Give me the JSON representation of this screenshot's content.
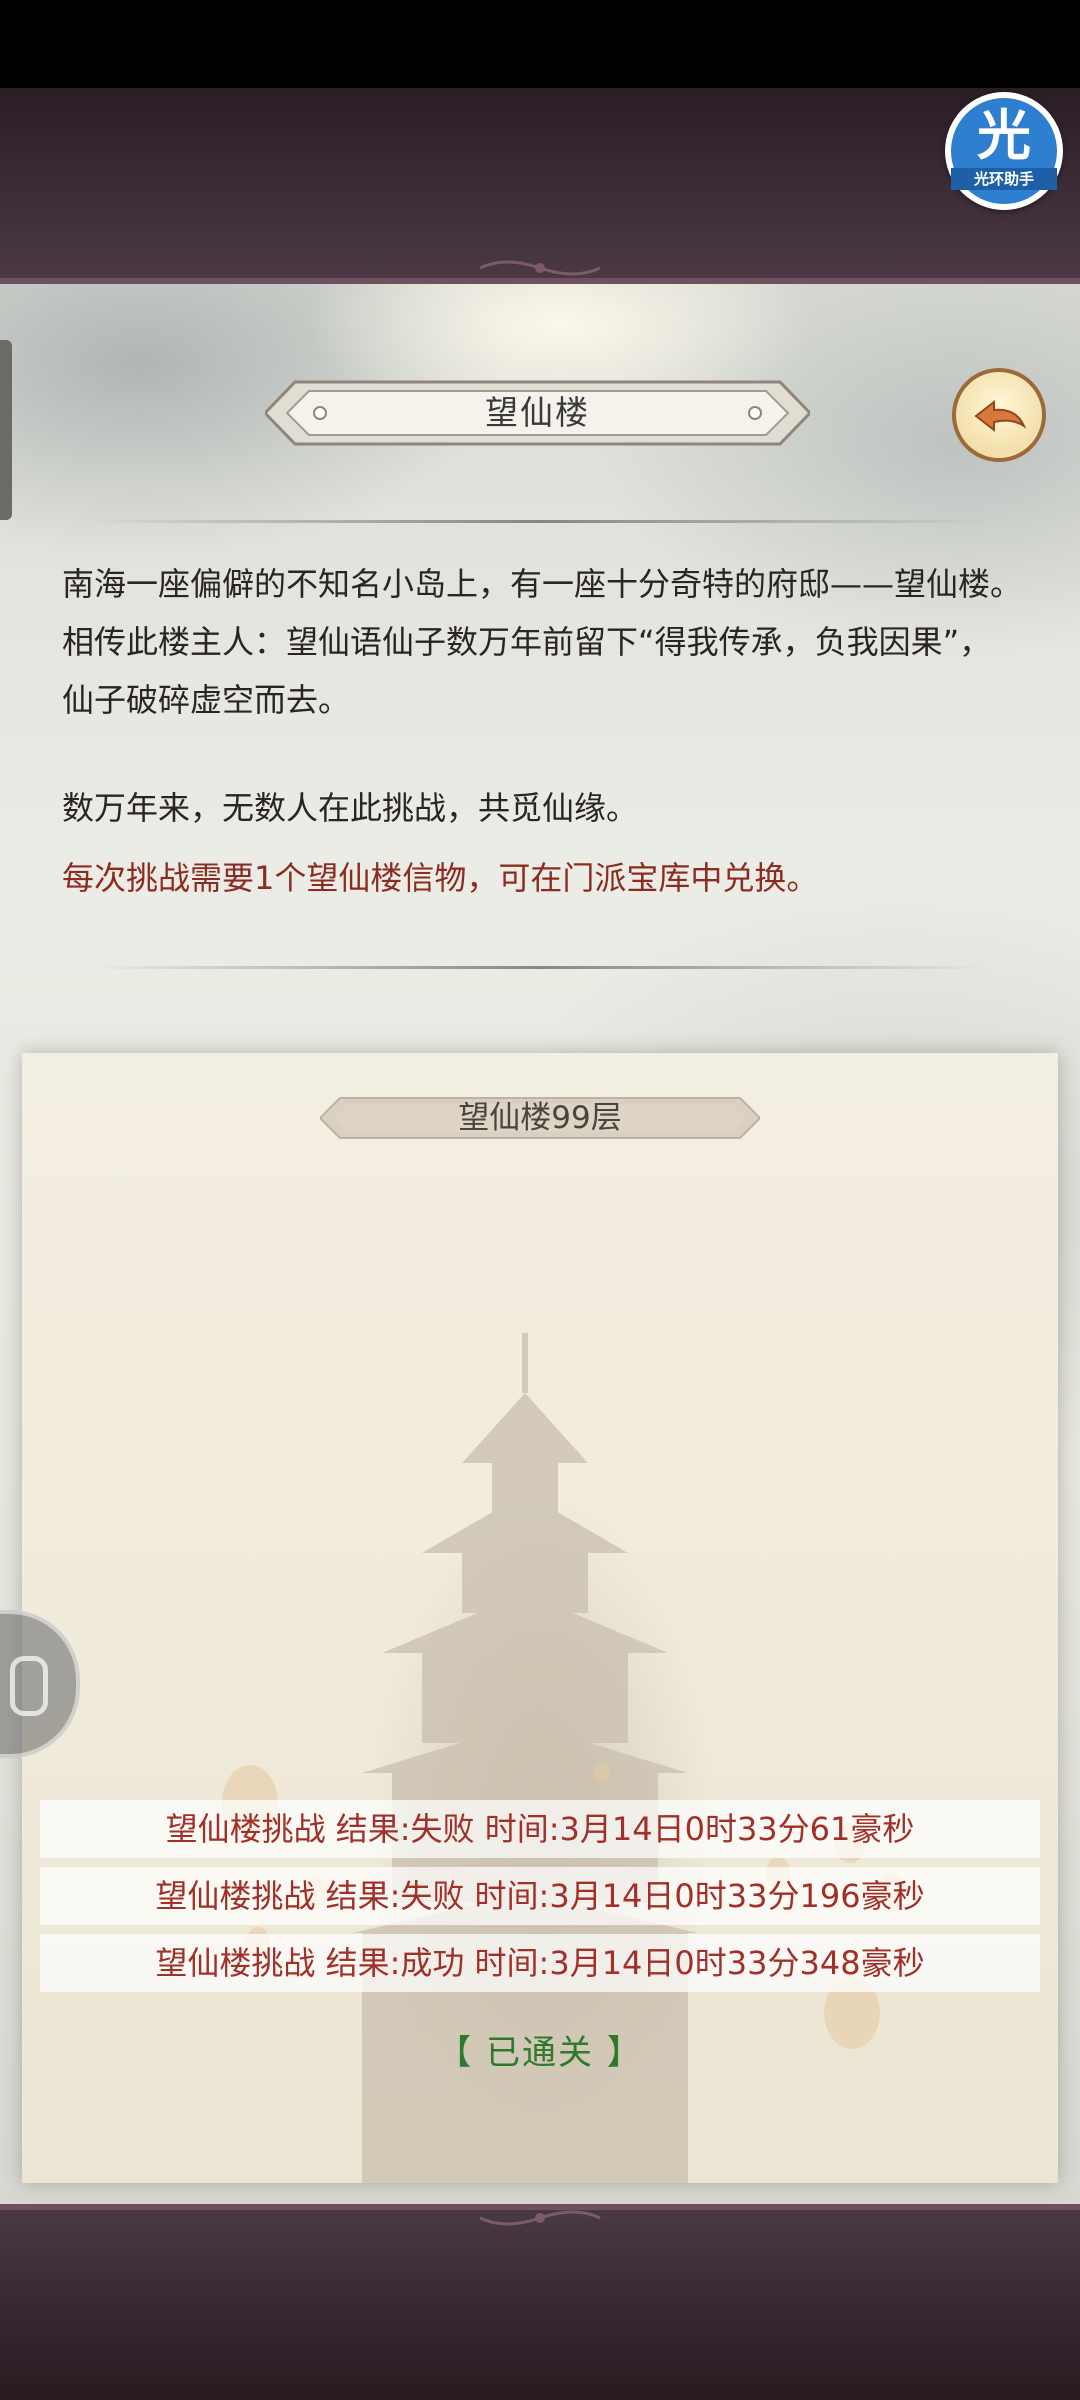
{
  "header": {
    "title": "望仙楼",
    "back_icon": "back-arrow-icon"
  },
  "helper_badge": {
    "glyph": "光",
    "label": "光环助手",
    "color": "#2f7fd0"
  },
  "intro": {
    "paragraph1": "南海一座偏僻的不知名小岛上，有一座十分奇特的府邸——望仙楼。相传此楼主人：望仙语仙子数万年前留下“得我传承，负我因果”，仙子破碎虚空而去。",
    "paragraph2": "数万年来，无数人在此挑战，共觅仙缘。",
    "note": "每次挑战需要1个望仙楼信物，可在门派宝库中兑换。",
    "note_color": "#8c2c20"
  },
  "tower": {
    "floor_label": "望仙楼99层",
    "records": [
      "望仙楼挑战 结果:失败 时间:3月14日0时33分61豪秒",
      "望仙楼挑战 结果:失败 时间:3月14日0时33分196豪秒",
      "望仙楼挑战 结果:成功 时间:3月14日0时33分348豪秒"
    ],
    "status": "【 已通关 】",
    "status_color": "#2e7a2a"
  }
}
